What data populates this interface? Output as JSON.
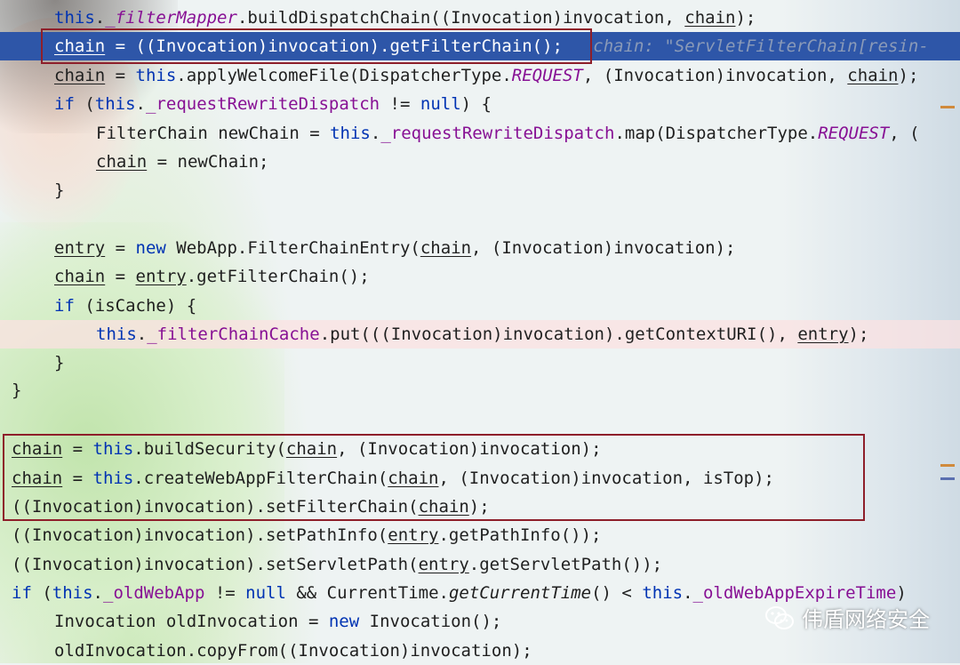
{
  "code_lines": [
    {
      "line": "this._filterMapper.buildDispatchChain((Invocation)invocation, chain);"
    },
    {
      "line": "chain = ((Invocation)invocation).getFilterChain();",
      "inline_hint": "chain: \"ServletFilterChain[resin-"
    },
    {
      "line": "chain = this.applyWelcomeFile(DispatcherType.REQUEST, (Invocation)invocation, chain);"
    },
    {
      "line": "if (this._requestRewriteDispatch != null) {"
    },
    {
      "line": "FilterChain newChain = this._requestRewriteDispatch.map(DispatcherType.REQUEST, ("
    },
    {
      "line": "chain = newChain;"
    },
    {
      "line": "}"
    },
    {
      "line": "entry = new WebApp.FilterChainEntry(chain, (Invocation)invocation);"
    },
    {
      "line": "chain = entry.getFilterChain();"
    },
    {
      "line": "if (isCache) {"
    },
    {
      "line": "this._filterChainCache.put(((Invocation)invocation).getContextURI(), entry);"
    },
    {
      "line": "}"
    },
    {
      "line": "}"
    },
    {
      "line": "chain = this.buildSecurity(chain, (Invocation)invocation);"
    },
    {
      "line": "chain = this.createWebAppFilterChain(chain, (Invocation)invocation, isTop);"
    },
    {
      "line": "((Invocation)invocation).setFilterChain(chain);"
    },
    {
      "line": "((Invocation)invocation).setPathInfo(entry.getPathInfo());"
    },
    {
      "line": "((Invocation)invocation).setServletPath(entry.getServletPath());"
    },
    {
      "line": "if (this._oldWebApp != null && CurrentTime.getCurrentTime() < this._oldWebAppExpireTime)"
    },
    {
      "line": "Invocation oldInvocation = new Invocation();"
    },
    {
      "line": "oldInvocation.copyFrom((Invocation)invocation);"
    }
  ],
  "watermark": {
    "text": "伟盾网络安全",
    "icon": "wechat-icon"
  },
  "colors": {
    "selection": "#2e56a8",
    "keyword": "#0033b3",
    "field": "#871094",
    "highlight_box": "#8e1f2a",
    "hint": "#8a9ab8"
  }
}
